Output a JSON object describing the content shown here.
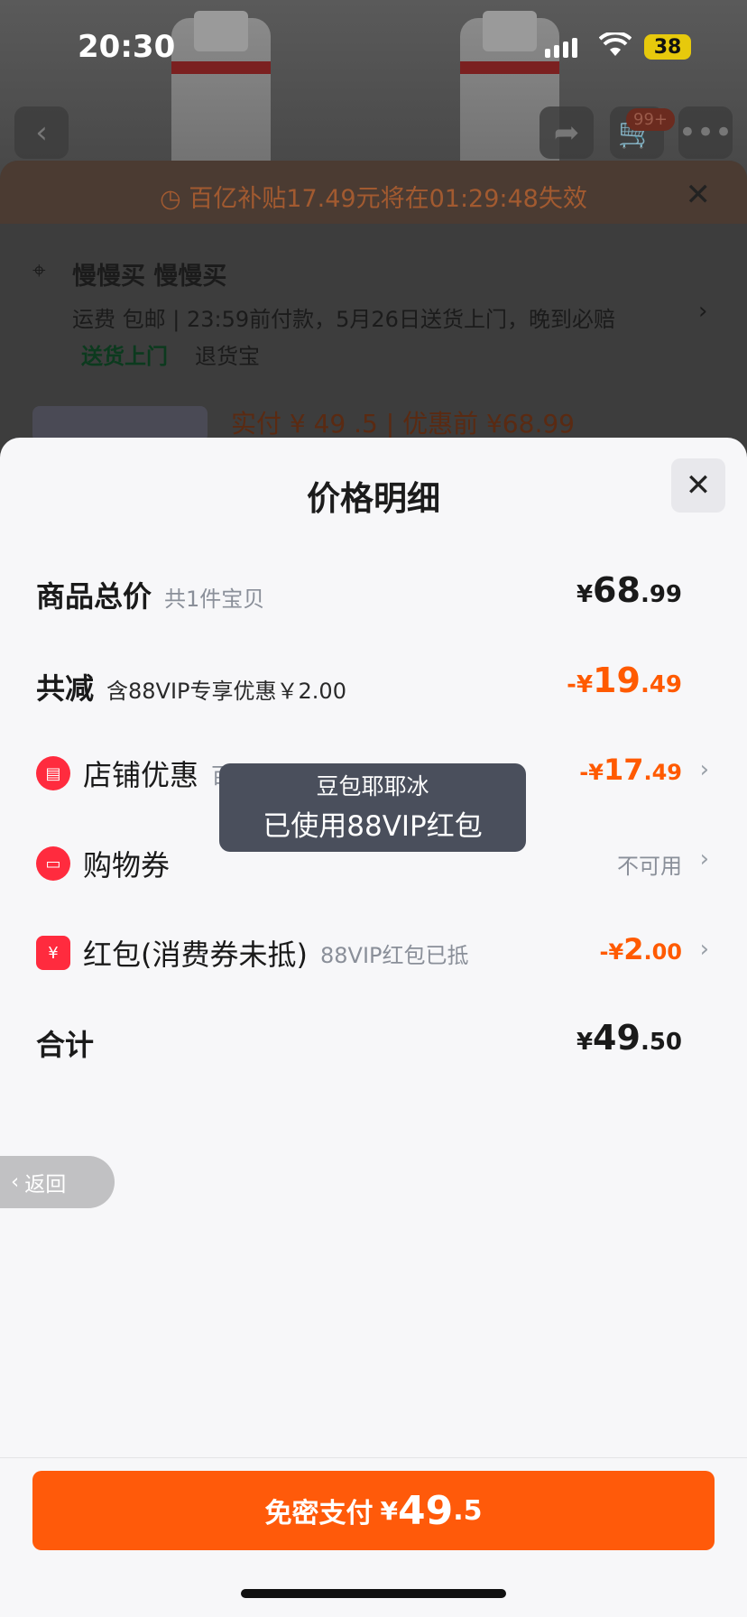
{
  "status_bar": {
    "time": "20:30",
    "battery": "38"
  },
  "background": {
    "cart_badge": "99+",
    "subsidy_banner": "百亿补贴17.49元将在01:29:48失效",
    "address_name": "慢慢买 慢慢买",
    "shipping_line": "运费 包邮 | 23:59前付款，5月26日送货上门，晚到必赔",
    "tag_delivery": "送货上门",
    "tag_return": "退货宝",
    "price_peek": "实付 ¥ 49 .5 | 优惠前 ¥68.99"
  },
  "panel": {
    "title": "价格明细",
    "rows": {
      "total": {
        "label": "商品总价",
        "sub": "共1件宝贝",
        "currency": "¥",
        "int": "68",
        "dec": ".99"
      },
      "reduced": {
        "label": "共减",
        "sub": "含88VIP专享优惠￥2.00",
        "currency": "-¥",
        "int": "19",
        "dec": ".49"
      },
      "store": {
        "label": "店铺优惠",
        "sub": "百亿补贴",
        "currency": "-¥",
        "int": "17",
        "dec": ".49"
      },
      "coupon": {
        "label": "购物券",
        "status": "不可用"
      },
      "redpacket": {
        "label": "红包(消费券未抵)",
        "sub": "88VIP红包已抵",
        "currency": "-¥",
        "int": "2",
        "dec": ".00"
      },
      "sum": {
        "label": "合计",
        "currency": "¥",
        "int": "49",
        "dec": ".50"
      }
    }
  },
  "toast": {
    "line1": "豆包耶耶冰",
    "line2": "已使用88VIP红包"
  },
  "back_pill": {
    "label": "返回"
  },
  "pay_button": {
    "label": "免密支付",
    "currency": "¥",
    "int": "49",
    "dec": ".5"
  },
  "colors": {
    "accent": "#ff5a0a",
    "discount": "#ff5a00",
    "icon_red": "#ff2b3e"
  }
}
